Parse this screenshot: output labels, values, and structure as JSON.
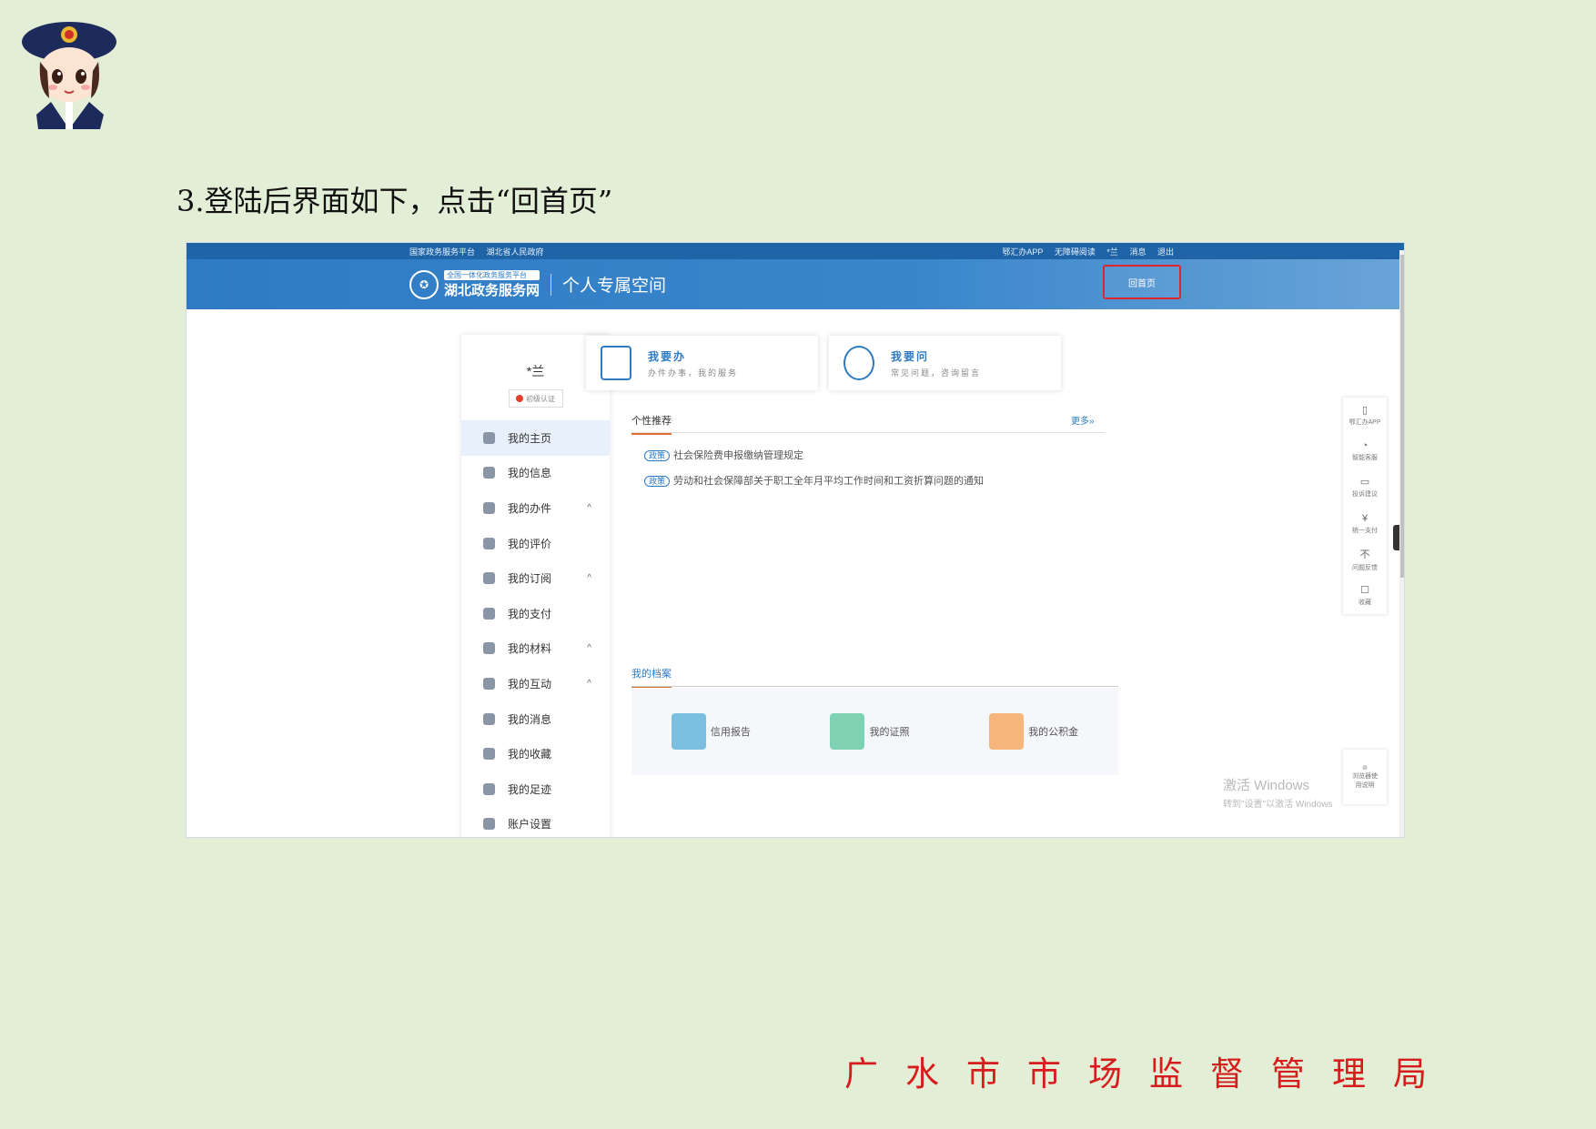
{
  "instruction": "3.登陆后界面如下，点击“回首页”",
  "footer": "广水市市场监督管理局",
  "browser": {
    "topbar": {
      "left": [
        "国家政务服务平台",
        "湖北省人民政府"
      ],
      "right": [
        "鄂汇办APP",
        "无障碍阅读",
        "*兰",
        "消息",
        "退出"
      ]
    },
    "header": {
      "logo_small": "全国一体化政务服务平台",
      "logo_main": "湖北政务服务网",
      "space_title": "个人专属空间",
      "home_button": "回首页"
    },
    "sidebar": {
      "username": "*兰",
      "auth_label": "初级认证",
      "items": [
        {
          "label": "我的主页",
          "chev": ""
        },
        {
          "label": "我的信息",
          "chev": ""
        },
        {
          "label": "我的办件",
          "chev": "^"
        },
        {
          "label": "我的评价",
          "chev": ""
        },
        {
          "label": "我的订阅",
          "chev": "^"
        },
        {
          "label": "我的支付",
          "chev": ""
        },
        {
          "label": "我的材料",
          "chev": "^"
        },
        {
          "label": "我的互动",
          "chev": "^"
        },
        {
          "label": "我的消息",
          "chev": ""
        },
        {
          "label": "我的收藏",
          "chev": ""
        },
        {
          "label": "我的足迹",
          "chev": ""
        },
        {
          "label": "账户设置",
          "chev": ""
        }
      ]
    },
    "cards": [
      {
        "title": "我要办",
        "subtitle": "办件办事，我的服务"
      },
      {
        "title": "我要问",
        "subtitle": "常见问题，咨询留言"
      }
    ],
    "recommend": {
      "title": "个性推荐",
      "more": "更多»",
      "items": [
        {
          "tag": "政策",
          "text": "社会保险费申报缴纳管理规定"
        },
        {
          "tag": "政策",
          "text": "劳动和社会保障部关于职工全年月平均工作时间和工资折算问题的通知"
        }
      ]
    },
    "archive": {
      "title": "我的档案",
      "items": [
        {
          "label": "信用报告",
          "color": "#7dbfe0"
        },
        {
          "label": "我的证照",
          "color": "#7fd1b4"
        },
        {
          "label": "我的公积金",
          "color": "#f6b57a"
        }
      ]
    },
    "floatbar": [
      {
        "icon": "▯",
        "label": "鄂汇办APP"
      },
      {
        "icon": "◔",
        "label": "智能客服"
      },
      {
        "icon": "▭",
        "label": "投诉建议"
      },
      {
        "icon": "¥",
        "label": "统一支付"
      },
      {
        "icon": "不",
        "label": "问题反馈"
      },
      {
        "icon": "☐",
        "label": "收藏"
      }
    ],
    "floatbar_bottom": "浏览器使用说明",
    "watermark": {
      "line1": "激活 Windows",
      "line2": "转到\"设置\"以激活 Windows"
    }
  }
}
